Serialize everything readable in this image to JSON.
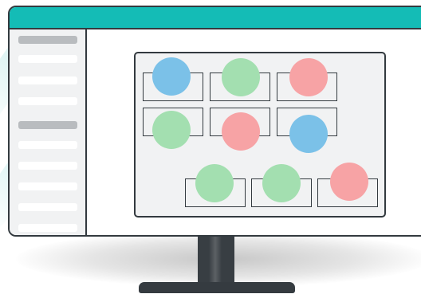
{
  "colors": {
    "topbar": "#14bcb6",
    "frame": "#333a3f",
    "surface": "#f1f2f3",
    "sidebar_heading_bar": "#b9bcbf",
    "sidebar_bar": "#ffffff",
    "dot_blue": "#7bc1e8",
    "dot_green": "#a3dfb0",
    "dot_red": "#f7a3a5",
    "stand": "#383e43"
  },
  "sidebar": {
    "groups": [
      {
        "heading": "placeholder-bar",
        "items": 3
      },
      {
        "heading": "placeholder-bar",
        "items": 5
      }
    ]
  },
  "grid": {
    "rows": [
      [
        "blue",
        "green",
        "red"
      ],
      [
        "green",
        "red",
        "blue"
      ],
      [
        "green",
        "green",
        "red"
      ]
    ]
  }
}
